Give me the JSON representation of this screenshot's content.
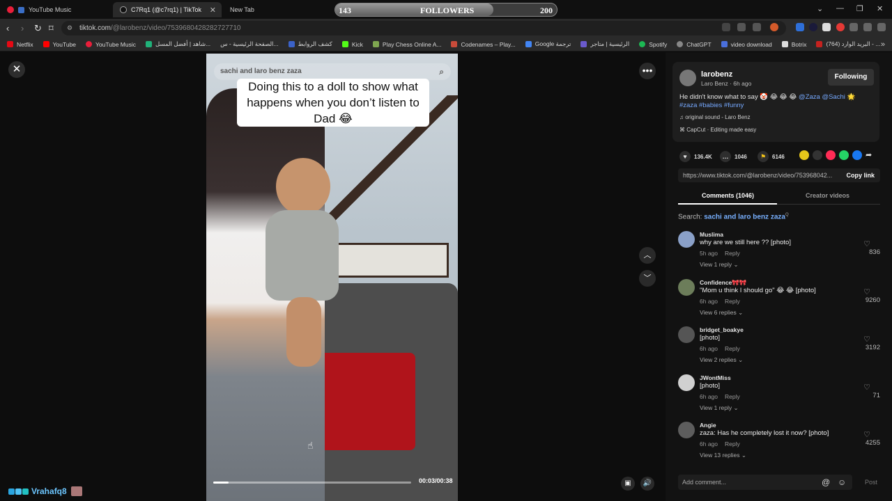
{
  "tabs": [
    {
      "label": "YouTube Music",
      "active": false
    },
    {
      "label": "C7Rq1 (@c7rq1) | TikTok",
      "active": true
    },
    {
      "label": "New Tab",
      "active": false
    }
  ],
  "followers_widget": {
    "start": "143",
    "label": "FOLLOWERS",
    "goal": "200",
    "progress_fraction": 0.715
  },
  "address": {
    "domain": "tiktok.com",
    "path": "/@larobenz/video/7539680428282727710"
  },
  "bookmarks": [
    "Netflix",
    "YouTube",
    "YouTube Music",
    "شاهد | أفضل المسل...",
    "الصفحة الرئيسية - س...",
    "كشف الروابط",
    "Kick",
    "Play Chess Online A...",
    "Codenames – Play...",
    "Google ترجمة",
    "الرئيسية | متاجر",
    "Spotify",
    "ChatGPT",
    "video download",
    "Botrix",
    "(764) البريد الوارد - ..."
  ],
  "video": {
    "search_text": "sachi and laro benz zaza",
    "caption": "Doing this to a doll to show what happens when you don’t listen to Dad 😂",
    "time": "00:03/00:38",
    "progress_fraction": 0.079
  },
  "overlay_user": "Vrahafq8",
  "post": {
    "username": "larobenz",
    "subtitle": "Laro Benz · 6h ago",
    "follow_label": "Following",
    "desc_text": "He didn't know what to say 🤡 😂 😂 😂",
    "desc_mentions": "@Zaza @Sachi 🌟",
    "desc_tags": "#zaza #babies #funny",
    "sound": "original sound - Laro Benz",
    "capcut": "CapCut · Editing made easy",
    "likes": "136.4K",
    "comments": "1046",
    "saves": "6146",
    "link": "https://www.tiktok.com/@larobenz/video/753968042...",
    "copy_label": "Copy link",
    "tab_comments": "Comments (1046)",
    "tab_creator": "Creator videos",
    "search_prefix": "Search:",
    "search_query": "sachi and laro benz zaza"
  },
  "comments": [
    {
      "name": "Muslima",
      "text": "why are we still here ?? [photo]",
      "time": "5h ago",
      "replies": "View 1 reply",
      "likes": "836"
    },
    {
      "name": "Confidence🎀🎀",
      "text": "\"Mom u think I should go\" 😂 😂 [photo]",
      "time": "6h ago",
      "replies": "View 6 replies",
      "likes": "9260"
    },
    {
      "name": "bridget_boakye",
      "text": "[photo]",
      "time": "6h ago",
      "replies": "View 2 replies",
      "likes": "3192"
    },
    {
      "name": "JWontMiss",
      "text": "[photo]",
      "time": "6h ago",
      "replies": "View 1 reply",
      "likes": "71"
    },
    {
      "name": "Angie",
      "text": "zaza: Has he completely lost it now? [photo]",
      "time": "6h ago",
      "replies": "View 13 replies",
      "likes": "4255"
    }
  ],
  "reply_label": "Reply",
  "add_comment_placeholder": "Add comment...",
  "post_label": "Post"
}
